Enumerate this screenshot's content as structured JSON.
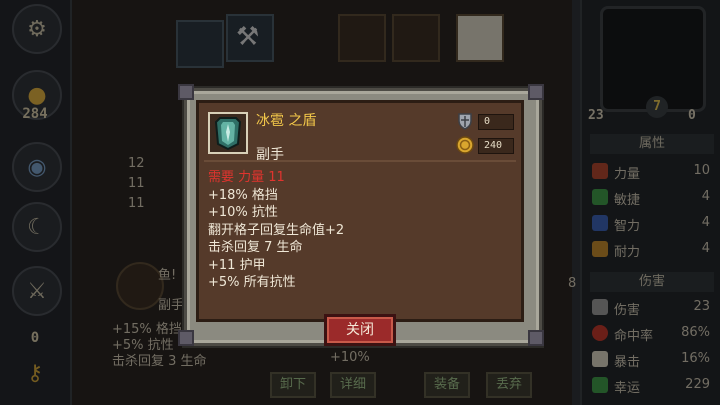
{
  "left_rail": {
    "gold_count": "284",
    "bottom_count": "0"
  },
  "background": {
    "item_name_partial": "鱼!",
    "item_type_partial": "副手",
    "stats": [
      "+15% 格挡",
      "+5% 抗性",
      "击杀回复 3 生命"
    ],
    "col_nums": [
      "12",
      "11",
      "11",
      "8"
    ],
    "misc_text": "+10%",
    "buttons": {
      "unequip": "卸下",
      "details": "详细",
      "equip": "装备",
      "discard": "丢弃"
    }
  },
  "right_panel": {
    "left_value": "23",
    "right_value": "0",
    "level": "7",
    "side_num": "8",
    "attributes_header": "属性",
    "attributes": [
      {
        "name": "力量",
        "value": "10",
        "color": "#b0472f"
      },
      {
        "name": "敏捷",
        "value": "4",
        "color": "#3f9a48"
      },
      {
        "name": "智力",
        "value": "4",
        "color": "#3c62b5"
      },
      {
        "name": "耐力",
        "value": "4",
        "color": "#c28a2e"
      }
    ],
    "damage_header": "伤害",
    "damage": [
      {
        "name": "伤害",
        "value": "23",
        "color": "#9a9a9a"
      },
      {
        "name": "命中率",
        "value": "86%",
        "color": "#c0392b"
      },
      {
        "name": "暴击",
        "value": "16%",
        "color": "#d9d2c0"
      },
      {
        "name": "幸运",
        "value": "229",
        "color": "#3f9a48"
      }
    ]
  },
  "popup": {
    "item_name": "冰雹 之盾",
    "item_type": "副手",
    "armor_value": "0",
    "price": "240",
    "requirement": "需要 力量 11",
    "lines": [
      "+18% 格挡",
      "+10% 抗性",
      "翻开格子回复生命值+2",
      "击杀回复 7 生命",
      "+11 护甲",
      "+5% 所有抗性"
    ],
    "close_label": "关闭"
  },
  "colors": {
    "popup_bg": "#553a2a",
    "item_name": "#f3c84a",
    "requirement": "#e0342e",
    "close_button": "#9b2a2a"
  },
  "icons": {
    "shield": "shield-icon",
    "coin": "coin-icon",
    "item": "ice-shield-item-icon",
    "gear": "gear-icon",
    "key": "key-icon",
    "sword": "sword-icon"
  }
}
